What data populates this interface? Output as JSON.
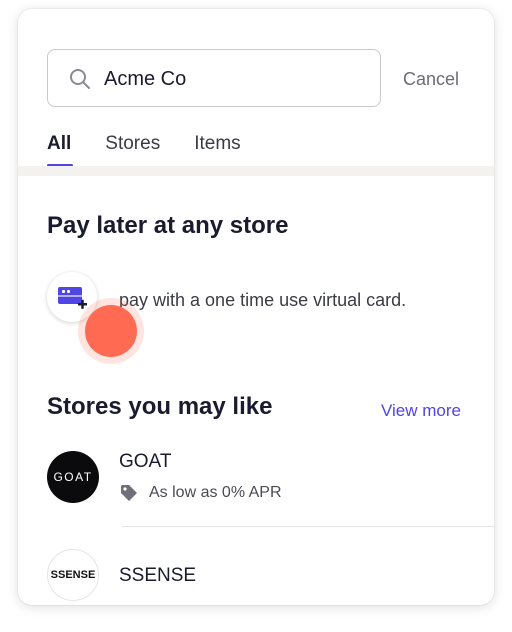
{
  "search": {
    "value": "Acme Co",
    "placeholder": "Search"
  },
  "cancel_label": "Cancel",
  "tabs": [
    {
      "label": "All",
      "active": true
    },
    {
      "label": "Stores",
      "active": false
    },
    {
      "label": "Items",
      "active": false
    }
  ],
  "pay_later": {
    "title": "Pay later at any store",
    "description": "pay with a one time use virtual card.",
    "icon": "virtual-card-plus-icon"
  },
  "stores_section": {
    "title": "Stores you may like",
    "view_more_label": "View more",
    "stores": [
      {
        "name": "GOAT",
        "logo_text": "GOAT",
        "offer": "As low as 0% APR"
      },
      {
        "name": "SSENSE",
        "logo_text": "SSENSE"
      }
    ]
  },
  "colors": {
    "accent": "#4f46e5",
    "touch_indicator": "#ff6b52"
  }
}
